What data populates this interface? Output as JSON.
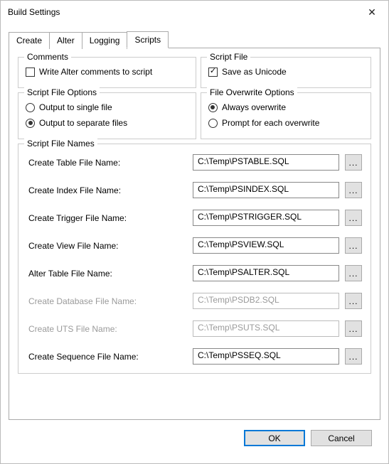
{
  "window": {
    "title": "Build Settings"
  },
  "tabs": [
    "Create",
    "Alter",
    "Logging",
    "Scripts"
  ],
  "activeTab": 3,
  "groups": {
    "comments": {
      "legend": "Comments",
      "writeAlter": {
        "label": "Write Alter comments to script",
        "checked": false
      }
    },
    "scriptFile": {
      "legend": "Script File",
      "unicode": {
        "label": "Save as Unicode",
        "checked": true
      }
    },
    "scriptFileOptions": {
      "legend": "Script File Options",
      "single": {
        "label": "Output to single file",
        "checked": false
      },
      "separate": {
        "label": "Output to separate files",
        "checked": true
      }
    },
    "overwrite": {
      "legend": "File Overwrite Options",
      "always": {
        "label": "Always overwrite",
        "checked": true
      },
      "prompt": {
        "label": "Prompt for each overwrite",
        "checked": false
      }
    },
    "fileNames": {
      "legend": "Script File Names",
      "rows": [
        {
          "label": "Create Table File Name:",
          "value": "C:\\Temp\\PSTABLE.SQL",
          "enabled": true
        },
        {
          "label": "Create Index File Name:",
          "value": "C:\\Temp\\PSINDEX.SQL",
          "enabled": true
        },
        {
          "label": "Create Trigger File Name:",
          "value": "C:\\Temp\\PSTRIGGER.SQL",
          "enabled": true
        },
        {
          "label": "Create View File Name:",
          "value": "C:\\Temp\\PSVIEW.SQL",
          "enabled": true
        },
        {
          "label": "Alter Table File Name:",
          "value": "C:\\Temp\\PSALTER.SQL",
          "enabled": true
        },
        {
          "label": "Create Database File Name:",
          "value": "C:\\Temp\\PSDB2.SQL",
          "enabled": false
        },
        {
          "label": "Create UTS File Name:",
          "value": "C:\\Temp\\PSUTS.SQL",
          "enabled": false
        },
        {
          "label": "Create Sequence File Name:",
          "value": "C:\\Temp\\PSSEQ.SQL",
          "enabled": true
        }
      ]
    }
  },
  "buttons": {
    "ok": "OK",
    "cancel": "Cancel",
    "browse": "..."
  }
}
